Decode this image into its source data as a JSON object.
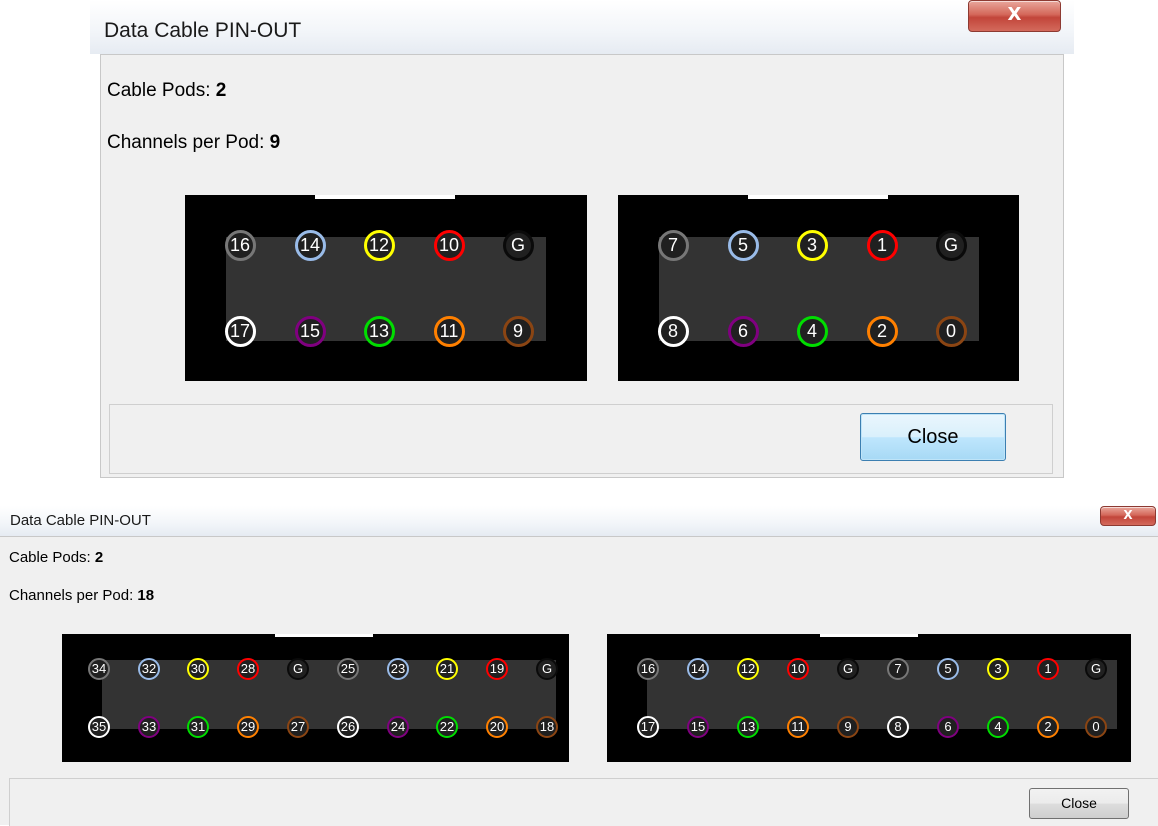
{
  "dialogs": [
    {
      "title": "Data Cable PIN-OUT",
      "close_glyph": "X",
      "cable_pods_label": "Cable Pods:",
      "cable_pods_value": "2",
      "channels_label": "Channels per Pod:",
      "channels_value": "9",
      "close_button_label": "Close",
      "pods": [
        {
          "top_pins": [
            {
              "label": "16",
              "color": "#777777"
            },
            {
              "label": "14",
              "color": "#99bbe8"
            },
            {
              "label": "12",
              "color": "#ffff00"
            },
            {
              "label": "10",
              "color": "#ff0000"
            },
            {
              "label": "G",
              "color": "#000000"
            }
          ],
          "bottom_pins": [
            {
              "label": "17",
              "color": "#ffffff"
            },
            {
              "label": "15",
              "color": "#800080"
            },
            {
              "label": "13",
              "color": "#00dd00"
            },
            {
              "label": "11",
              "color": "#ff8000"
            },
            {
              "label": "9",
              "color": "#8b4513"
            }
          ]
        },
        {
          "top_pins": [
            {
              "label": "7",
              "color": "#777777"
            },
            {
              "label": "5",
              "color": "#99bbe8"
            },
            {
              "label": "3",
              "color": "#ffff00"
            },
            {
              "label": "1",
              "color": "#ff0000"
            },
            {
              "label": "G",
              "color": "#000000"
            }
          ],
          "bottom_pins": [
            {
              "label": "8",
              "color": "#ffffff"
            },
            {
              "label": "6",
              "color": "#800080"
            },
            {
              "label": "4",
              "color": "#00dd00"
            },
            {
              "label": "2",
              "color": "#ff8000"
            },
            {
              "label": "0",
              "color": "#8b4513"
            }
          ]
        }
      ]
    },
    {
      "title": "Data Cable PIN-OUT",
      "close_glyph": "X",
      "cable_pods_label": "Cable Pods:",
      "cable_pods_value": "2",
      "channels_label": "Channels per Pod:",
      "channels_value": "18",
      "close_button_label": "Close",
      "pods": [
        {
          "top_pins": [
            {
              "label": "34",
              "color": "#777777"
            },
            {
              "label": "32",
              "color": "#99bbe8"
            },
            {
              "label": "30",
              "color": "#ffff00"
            },
            {
              "label": "28",
              "color": "#ff0000"
            },
            {
              "label": "G",
              "color": "#000000"
            },
            {
              "label": "25",
              "color": "#777777"
            },
            {
              "label": "23",
              "color": "#99bbe8"
            },
            {
              "label": "21",
              "color": "#ffff00"
            },
            {
              "label": "19",
              "color": "#ff0000"
            },
            {
              "label": "G",
              "color": "#000000"
            }
          ],
          "bottom_pins": [
            {
              "label": "35",
              "color": "#ffffff"
            },
            {
              "label": "33",
              "color": "#800080"
            },
            {
              "label": "31",
              "color": "#00dd00"
            },
            {
              "label": "29",
              "color": "#ff8000"
            },
            {
              "label": "27",
              "color": "#8b4513"
            },
            {
              "label": "26",
              "color": "#ffffff"
            },
            {
              "label": "24",
              "color": "#800080"
            },
            {
              "label": "22",
              "color": "#00dd00"
            },
            {
              "label": "20",
              "color": "#ff8000"
            },
            {
              "label": "18",
              "color": "#8b4513"
            }
          ]
        },
        {
          "top_pins": [
            {
              "label": "16",
              "color": "#777777"
            },
            {
              "label": "14",
              "color": "#99bbe8"
            },
            {
              "label": "12",
              "color": "#ffff00"
            },
            {
              "label": "10",
              "color": "#ff0000"
            },
            {
              "label": "G",
              "color": "#000000"
            },
            {
              "label": "7",
              "color": "#777777"
            },
            {
              "label": "5",
              "color": "#99bbe8"
            },
            {
              "label": "3",
              "color": "#ffff00"
            },
            {
              "label": "1",
              "color": "#ff0000"
            },
            {
              "label": "G",
              "color": "#000000"
            }
          ],
          "bottom_pins": [
            {
              "label": "17",
              "color": "#ffffff"
            },
            {
              "label": "15",
              "color": "#800080"
            },
            {
              "label": "13",
              "color": "#00dd00"
            },
            {
              "label": "11",
              "color": "#ff8000"
            },
            {
              "label": "9",
              "color": "#8b4513"
            },
            {
              "label": "8",
              "color": "#ffffff"
            },
            {
              "label": "6",
              "color": "#800080"
            },
            {
              "label": "4",
              "color": "#00dd00"
            },
            {
              "label": "2",
              "color": "#ff8000"
            },
            {
              "label": "0",
              "color": "#8b4513"
            }
          ]
        }
      ]
    }
  ]
}
